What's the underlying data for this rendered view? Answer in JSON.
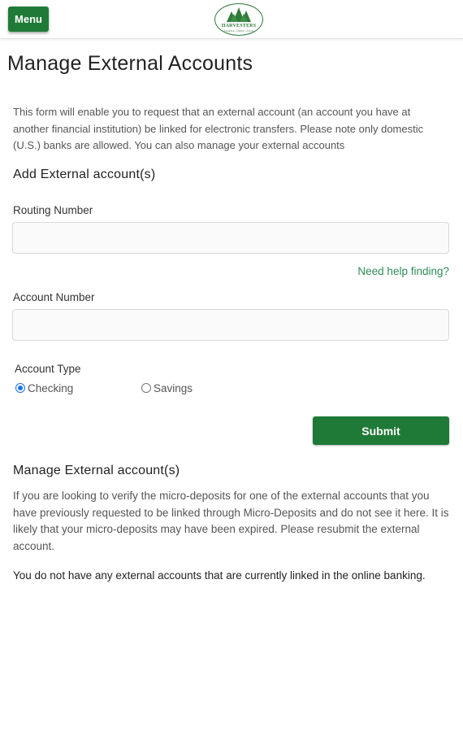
{
  "header": {
    "menu_label": "Menu",
    "logo_name": "HARVESTERS",
    "logo_sub": "FEDERAL CREDIT UNION",
    "logo_icon": "pine-trees-logo"
  },
  "page": {
    "title": "Manage External Accounts",
    "intro": "This form will enable you to request that an external account (an account you have at another financial institution) be linked for electronic transfers. Please note only domestic (U.S.) banks are allowed. You can also manage your external accounts"
  },
  "add_section": {
    "title": "Add External account(s)",
    "routing_label": "Routing Number",
    "routing_value": "",
    "help_link": "Need help finding?",
    "account_label": "Account Number",
    "account_value": "",
    "account_type_label": "Account Type",
    "options": [
      {
        "label": "Checking",
        "selected": true
      },
      {
        "label": "Savings",
        "selected": false
      }
    ],
    "submit_label": "Submit"
  },
  "manage_section": {
    "title": "Manage External account(s)",
    "description": "If you are looking to verify the micro-deposits for one of the external accounts that you have previously requested to be linked through Micro-Deposits and do not see it here. It is likely that your micro-deposits may have been expired. Please resubmit the external account.",
    "empty_message": "You do not have any external accounts that are currently linked in the online banking."
  },
  "colors": {
    "brand_green": "#1f7a37",
    "link_green": "#2e8b57",
    "radio_blue": "#1a73e8"
  }
}
